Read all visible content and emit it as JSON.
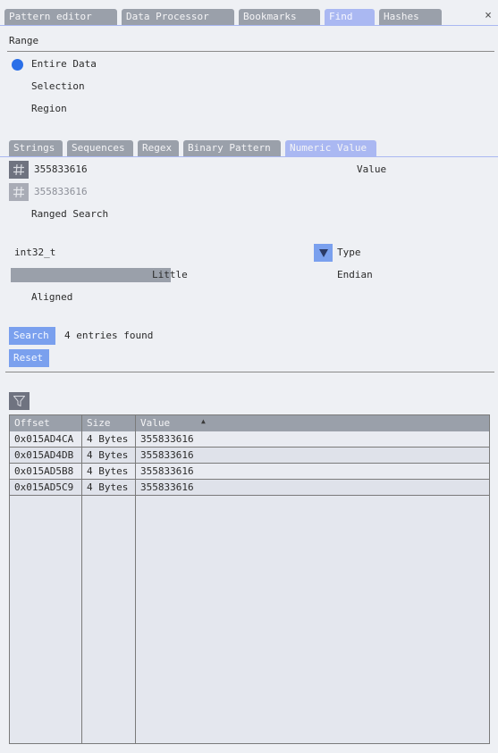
{
  "tabs": [
    {
      "label": "Pattern editor",
      "active": false
    },
    {
      "label": "Data Processor",
      "active": false
    },
    {
      "label": "Bookmarks",
      "active": false
    },
    {
      "label": "Find",
      "active": true
    },
    {
      "label": "Hashes",
      "active": false
    }
  ],
  "close_glyph": "×",
  "range": {
    "heading": "Range",
    "options": [
      {
        "label": "Entire Data",
        "selected": true
      },
      {
        "label": "Selection",
        "selected": false
      },
      {
        "label": "Region",
        "selected": false
      }
    ]
  },
  "mode_tabs": [
    {
      "label": "Strings",
      "active": false
    },
    {
      "label": "Sequences",
      "active": false
    },
    {
      "label": "Regex",
      "active": false
    },
    {
      "label": "Binary Pattern",
      "active": false
    },
    {
      "label": "Numeric Value",
      "active": true
    }
  ],
  "numeric": {
    "value_input": "355833616",
    "value_label": "Value",
    "max_input": "355833616",
    "ranged_search_label": "Ranged Search",
    "type_value": "int32_t",
    "type_label": "Type",
    "endian_value": "Little",
    "endian_label": "Endian",
    "aligned_label": "Aligned"
  },
  "actions": {
    "search_label": "Search",
    "status": "4 entries found",
    "reset_label": "Reset"
  },
  "results": {
    "sort_glyph": "▲",
    "columns": [
      "Offset",
      "Size",
      "Value"
    ],
    "rows": [
      [
        "0x015AD4CA",
        "4 Bytes",
        "355833616"
      ],
      [
        "0x015AD4DB",
        "4 Bytes",
        "355833616"
      ],
      [
        "0x015AD5B8",
        "4 Bytes",
        "355833616"
      ],
      [
        "0x015AD5C9",
        "4 Bytes",
        "355833616"
      ]
    ]
  },
  "colors": {
    "accent": "#aab8f2",
    "button": "#7aa0ee",
    "radio_on": "#2a6fe8",
    "tab_inactive": "#9aa0aa"
  },
  "icons": {
    "value_hash": "hash-icon",
    "max_hash": "hash-icon",
    "combo_arrow": "chevron-down-icon",
    "filter": "filter-icon",
    "close": "close-icon"
  }
}
